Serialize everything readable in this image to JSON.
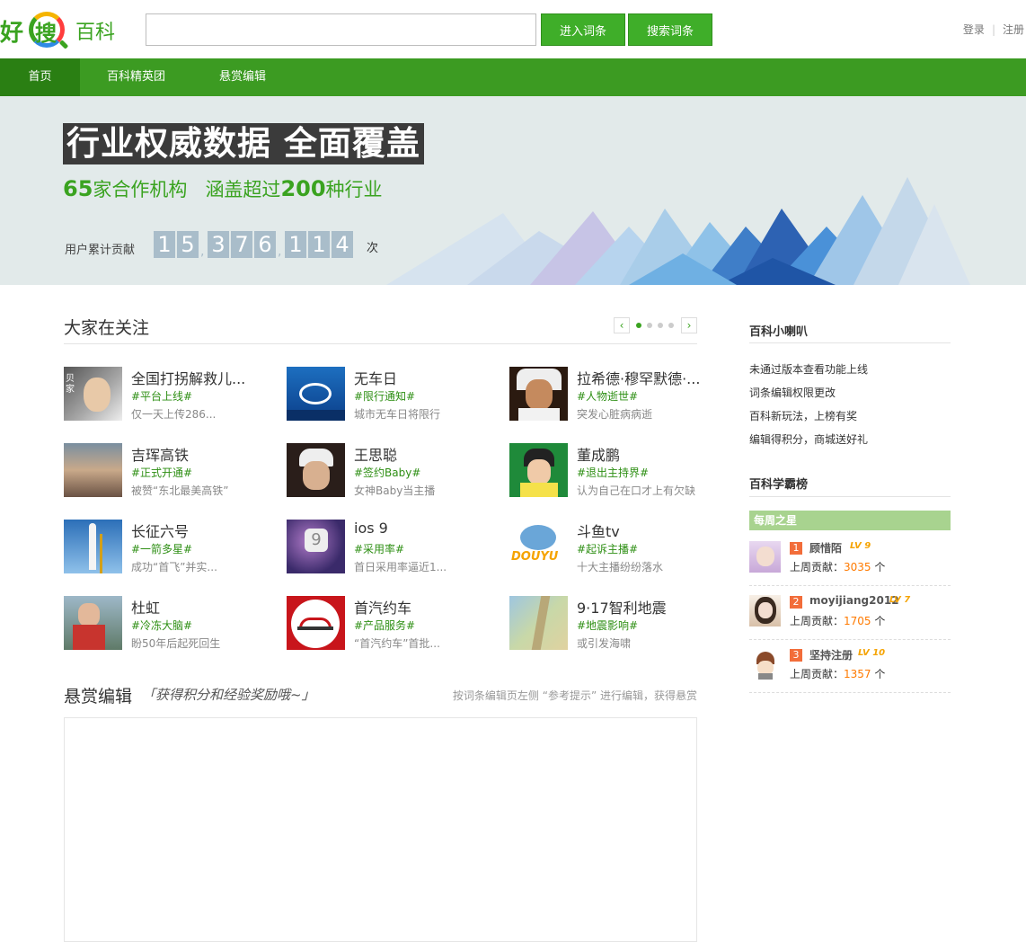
{
  "header": {
    "logo": {
      "hao": "好",
      "sou": "搜",
      "baike": "百科"
    },
    "search_value": "",
    "enter_label": "进入词条",
    "search_label": "搜索词条",
    "login_label": "登录",
    "register_label": "注册"
  },
  "nav": [
    {
      "label": "首页"
    },
    {
      "label": "百科精英团"
    },
    {
      "label": "悬赏编辑"
    }
  ],
  "banner": {
    "title": "行业权威数据 全面覆盖",
    "sub_num1": "65",
    "sub_text1": "家合作机构",
    "sub_text2": "涵盖超过",
    "sub_num2": "200",
    "sub_text3": "种行业",
    "counter_label": "用户累计贡献",
    "digits": [
      "1",
      "5",
      "3",
      "7",
      "6",
      "1",
      "1",
      "4"
    ],
    "counter_unit": "次"
  },
  "hot": {
    "title": "大家在关注",
    "prev": "‹",
    "next": "›",
    "items": [
      {
        "name": "全国打拐解救儿...",
        "tag": "#平台上线#",
        "desc": "仅一天上传286...",
        "thumb_text": "贝家"
      },
      {
        "name": "无车日",
        "tag": "#限行通知#",
        "desc": "城市无车日将限行",
        "thumb_text": ""
      },
      {
        "name": "拉希德·穆罕默德·...",
        "tag": "#人物逝世#",
        "desc": "突发心脏病病逝",
        "thumb_text": ""
      },
      {
        "name": "吉珲高铁",
        "tag": "#正式开通#",
        "desc": "被赞“东北最美高铁”",
        "thumb_text": ""
      },
      {
        "name": "王思聪",
        "tag": "#签约Baby#",
        "desc": "女神Baby当主播",
        "thumb_text": ""
      },
      {
        "name": "董成鹏",
        "tag": "#退出主持界#",
        "desc": "认为自己在口才上有欠缺",
        "thumb_text": ""
      },
      {
        "name": "长征六号",
        "tag": "#一箭多星#",
        "desc": "成功“首飞”并实...",
        "thumb_text": ""
      },
      {
        "name": "ios 9",
        "tag": "#采用率#",
        "desc": "首日采用率逼近1...",
        "thumb_text": "9"
      },
      {
        "name": "斗鱼tv",
        "tag": "#起诉主播#",
        "desc": "十大主播纷纷落水",
        "thumb_text": "DOUYU"
      },
      {
        "name": "杜虹",
        "tag": "#冷冻大脑#",
        "desc": "盼50年后起死回生",
        "thumb_text": ""
      },
      {
        "name": "首汽约车",
        "tag": "#产品服务#",
        "desc": "“首汽约车”首批...",
        "thumb_text": ""
      },
      {
        "name": "9·17智利地震",
        "tag": "#地震影响#",
        "desc": "或引发海啸",
        "thumb_text": ""
      }
    ]
  },
  "reward": {
    "title": "悬赏编辑",
    "slogan": "「获得积分和经验奖励哦~」",
    "tip": "按词条编辑页左侧 “参考提示” 进行编辑，获得悬赏"
  },
  "sidebar": {
    "notice_title": "百科小喇叭",
    "notices": [
      "未通过版本查看功能上线",
      "词条编辑权限更改",
      "百科新玩法，上榜有奖",
      "编辑得积分，商城送好礼"
    ],
    "rank_title": "百科学霸榜",
    "week_label": "每周之星",
    "contrib_label": "上周贡献：",
    "unit": "个",
    "ranks": [
      {
        "num": "1",
        "name": "顾惜陌",
        "lv": "LV 9",
        "value": "3035"
      },
      {
        "num": "2",
        "name": "moyijiang2012",
        "lv": "LV 7",
        "value": "1705"
      },
      {
        "num": "3",
        "name": "坚持注册",
        "lv": "LV 10",
        "value": "1357"
      }
    ]
  },
  "colors": {
    "brand_green": "#3c9b22",
    "nav_active": "#2a7f13",
    "tag_green": "#2e8f14",
    "digit_bg": "#a9bdca"
  }
}
